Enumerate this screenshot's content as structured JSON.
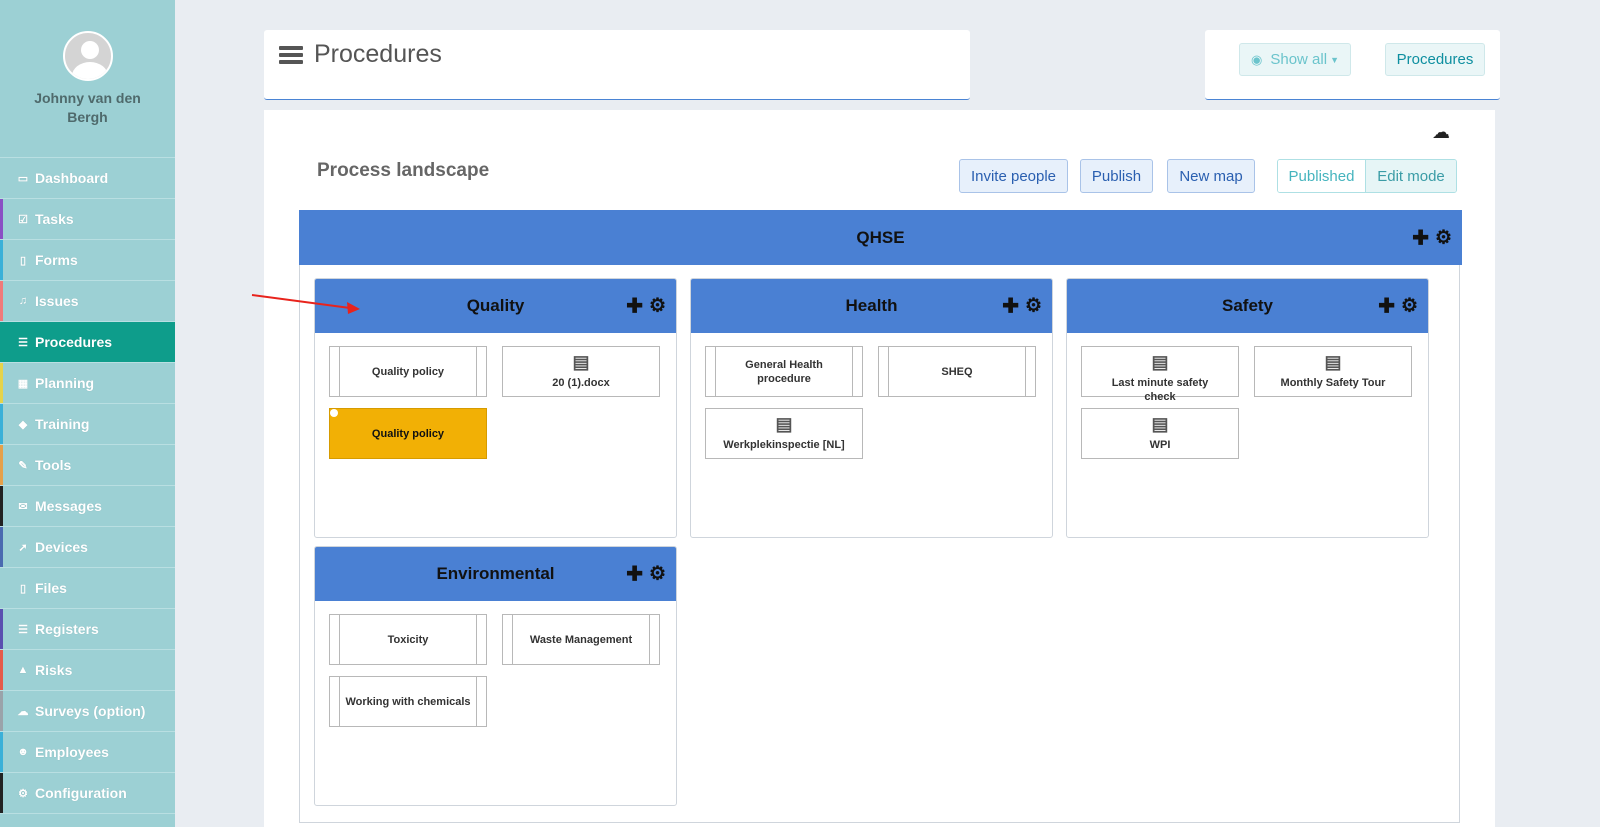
{
  "user": {
    "name": "Johnny van den Bergh"
  },
  "sidebar": {
    "items": [
      {
        "label": "Dashboard",
        "icon": "monitor-icon",
        "glyph": "▭",
        "stripe": "#9cd0d4"
      },
      {
        "label": "Tasks",
        "icon": "checkbox-icon",
        "glyph": "☑",
        "stripe": "#8a4fc4"
      },
      {
        "label": "Forms",
        "icon": "file-icon",
        "glyph": "▯",
        "stripe": "#3ab0d8"
      },
      {
        "label": "Issues",
        "icon": "bell-icon",
        "glyph": "♫",
        "stripe": "#f07a7a"
      },
      {
        "label": "Procedures",
        "icon": "procedures-icon",
        "glyph": "☰",
        "stripe": "#0e9d8b",
        "active": true
      },
      {
        "label": "Planning",
        "icon": "calendar-icon",
        "glyph": "▦",
        "stripe": "#e5d34a"
      },
      {
        "label": "Training",
        "icon": "graduation-cap-icon",
        "glyph": "◆",
        "stripe": "#3ab0d8"
      },
      {
        "label": "Tools",
        "icon": "wrench-icon",
        "glyph": "✎",
        "stripe": "#e5a04a"
      },
      {
        "label": "Messages",
        "icon": "envelope-icon",
        "glyph": "✉",
        "stripe": "#222222"
      },
      {
        "label": "Devices",
        "icon": "rocket-icon",
        "glyph": "➚",
        "stripe": "#4a6ab0"
      },
      {
        "label": "Files",
        "icon": "document-icon",
        "glyph": "▯",
        "stripe": "#9cd0d4"
      },
      {
        "label": "Registers",
        "icon": "list-icon",
        "glyph": "☰",
        "stripe": "#5a4fb0"
      },
      {
        "label": "Risks",
        "icon": "warning-icon",
        "glyph": "▲",
        "stripe": "#e55a4a"
      },
      {
        "label": "Surveys (option)",
        "icon": "comment-icon",
        "glyph": "☁",
        "stripe": "#9aa3aa"
      },
      {
        "label": "Employees",
        "icon": "users-icon",
        "glyph": "☻",
        "stripe": "#3ab0d8"
      },
      {
        "label": "Configuration",
        "icon": "gear-icon",
        "glyph": "⚙",
        "stripe": "#222222"
      }
    ]
  },
  "header": {
    "title": "Procedures"
  },
  "toolbar": {
    "show_all": "Show all",
    "procedures": "Procedures"
  },
  "main": {
    "section_title": "Process landscape",
    "buttons": {
      "invite": "Invite people",
      "publish": "Publish",
      "new_map": "New map"
    },
    "segment": {
      "published": "Published",
      "edit_mode": "Edit mode"
    }
  },
  "map": {
    "title": "QHSE",
    "groups": [
      {
        "title": "Quality",
        "tiles": [
          {
            "label": "Quality policy",
            "kind": "proc"
          },
          {
            "label": "20 (1).docx",
            "kind": "doc",
            "icon": "pdf-icon"
          },
          {
            "label": "Quality policy",
            "kind": "highlight"
          }
        ]
      },
      {
        "title": "Health",
        "tiles": [
          {
            "label": "General Health procedure",
            "kind": "proc"
          },
          {
            "label": "SHEQ",
            "kind": "proc"
          },
          {
            "label": "Werkplekinspectie [NL]",
            "kind": "doc",
            "icon": "document-icon"
          }
        ]
      },
      {
        "title": "Safety",
        "tiles": [
          {
            "label": "Last minute safety check",
            "kind": "doc",
            "icon": "document-icon"
          },
          {
            "label": "Monthly Safety Tour",
            "kind": "doc",
            "icon": "document-icon"
          },
          {
            "label": "WPI",
            "kind": "doc",
            "icon": "document-icon"
          }
        ]
      },
      {
        "title": "Environmental",
        "tiles": [
          {
            "label": "Toxicity",
            "kind": "proc"
          },
          {
            "label": "Waste Management",
            "kind": "proc"
          },
          {
            "label": "Working with chemicals",
            "kind": "proc"
          }
        ]
      }
    ]
  },
  "colors": {
    "accent": "#0e9d8b",
    "group_header": "#4a80d3",
    "highlight": "#f2b005",
    "annotation_arrow": "#e8231c"
  }
}
